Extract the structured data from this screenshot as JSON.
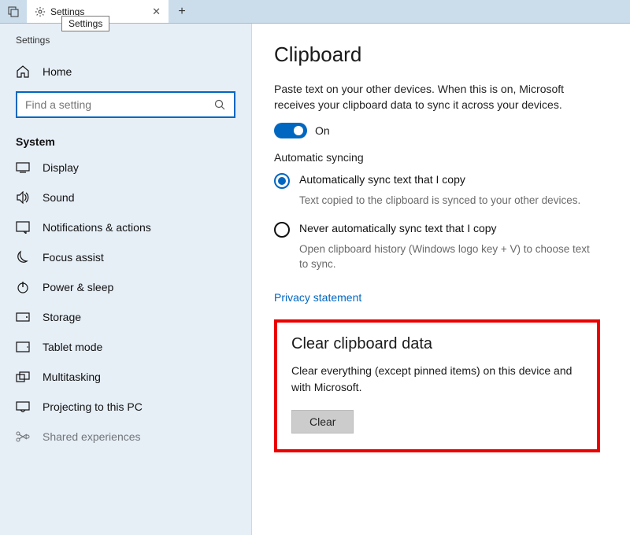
{
  "titlebar": {
    "tab_icon": "gear-icon",
    "tab_title": "Settings",
    "tooltip": "Settings"
  },
  "sidebar": {
    "app_name": "Settings",
    "home": "Home",
    "search_placeholder": "Find a setting",
    "section_label": "System",
    "items": [
      {
        "icon": "display-icon",
        "label": "Display"
      },
      {
        "icon": "sound-icon",
        "label": "Sound"
      },
      {
        "icon": "notifications-icon",
        "label": "Notifications & actions"
      },
      {
        "icon": "focus-icon",
        "label": "Focus assist"
      },
      {
        "icon": "power-icon",
        "label": "Power & sleep"
      },
      {
        "icon": "storage-icon",
        "label": "Storage"
      },
      {
        "icon": "tablet-icon",
        "label": "Tablet mode"
      },
      {
        "icon": "multitasking-icon",
        "label": "Multitasking"
      },
      {
        "icon": "projecting-icon",
        "label": "Projecting to this PC"
      },
      {
        "icon": "shared-icon",
        "label": "Shared experiences"
      }
    ]
  },
  "main": {
    "title": "Clipboard",
    "desc": "Paste text on your other devices. When this is on, Microsoft receives your clipboard data to sync it across your devices.",
    "toggle_label": "On",
    "sync_heading": "Automatic syncing",
    "opt_auto": "Automatically sync text that I copy",
    "opt_auto_sub": "Text copied to the clipboard is synced to your other devices.",
    "opt_never": "Never automatically sync text that I copy",
    "opt_never_sub": "Open clipboard history (Windows logo key + V) to choose text to sync.",
    "privacy_link": "Privacy statement",
    "clear_title": "Clear clipboard data",
    "clear_desc": "Clear everything (except pinned items) on this device and with Microsoft.",
    "clear_button": "Clear"
  }
}
